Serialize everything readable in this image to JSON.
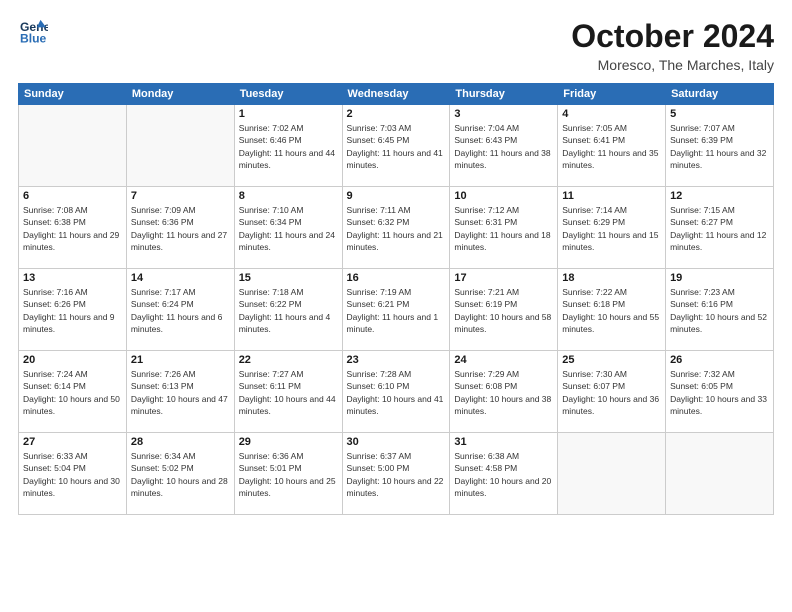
{
  "header": {
    "logo_line1": "General",
    "logo_line2": "Blue",
    "month": "October 2024",
    "location": "Moresco, The Marches, Italy"
  },
  "weekdays": [
    "Sunday",
    "Monday",
    "Tuesday",
    "Wednesday",
    "Thursday",
    "Friday",
    "Saturday"
  ],
  "weeks": [
    [
      {
        "day": "",
        "info": ""
      },
      {
        "day": "",
        "info": ""
      },
      {
        "day": "1",
        "info": "Sunrise: 7:02 AM\nSunset: 6:46 PM\nDaylight: 11 hours and 44 minutes."
      },
      {
        "day": "2",
        "info": "Sunrise: 7:03 AM\nSunset: 6:45 PM\nDaylight: 11 hours and 41 minutes."
      },
      {
        "day": "3",
        "info": "Sunrise: 7:04 AM\nSunset: 6:43 PM\nDaylight: 11 hours and 38 minutes."
      },
      {
        "day": "4",
        "info": "Sunrise: 7:05 AM\nSunset: 6:41 PM\nDaylight: 11 hours and 35 minutes."
      },
      {
        "day": "5",
        "info": "Sunrise: 7:07 AM\nSunset: 6:39 PM\nDaylight: 11 hours and 32 minutes."
      }
    ],
    [
      {
        "day": "6",
        "info": "Sunrise: 7:08 AM\nSunset: 6:38 PM\nDaylight: 11 hours and 29 minutes."
      },
      {
        "day": "7",
        "info": "Sunrise: 7:09 AM\nSunset: 6:36 PM\nDaylight: 11 hours and 27 minutes."
      },
      {
        "day": "8",
        "info": "Sunrise: 7:10 AM\nSunset: 6:34 PM\nDaylight: 11 hours and 24 minutes."
      },
      {
        "day": "9",
        "info": "Sunrise: 7:11 AM\nSunset: 6:32 PM\nDaylight: 11 hours and 21 minutes."
      },
      {
        "day": "10",
        "info": "Sunrise: 7:12 AM\nSunset: 6:31 PM\nDaylight: 11 hours and 18 minutes."
      },
      {
        "day": "11",
        "info": "Sunrise: 7:14 AM\nSunset: 6:29 PM\nDaylight: 11 hours and 15 minutes."
      },
      {
        "day": "12",
        "info": "Sunrise: 7:15 AM\nSunset: 6:27 PM\nDaylight: 11 hours and 12 minutes."
      }
    ],
    [
      {
        "day": "13",
        "info": "Sunrise: 7:16 AM\nSunset: 6:26 PM\nDaylight: 11 hours and 9 minutes."
      },
      {
        "day": "14",
        "info": "Sunrise: 7:17 AM\nSunset: 6:24 PM\nDaylight: 11 hours and 6 minutes."
      },
      {
        "day": "15",
        "info": "Sunrise: 7:18 AM\nSunset: 6:22 PM\nDaylight: 11 hours and 4 minutes."
      },
      {
        "day": "16",
        "info": "Sunrise: 7:19 AM\nSunset: 6:21 PM\nDaylight: 11 hours and 1 minute."
      },
      {
        "day": "17",
        "info": "Sunrise: 7:21 AM\nSunset: 6:19 PM\nDaylight: 10 hours and 58 minutes."
      },
      {
        "day": "18",
        "info": "Sunrise: 7:22 AM\nSunset: 6:18 PM\nDaylight: 10 hours and 55 minutes."
      },
      {
        "day": "19",
        "info": "Sunrise: 7:23 AM\nSunset: 6:16 PM\nDaylight: 10 hours and 52 minutes."
      }
    ],
    [
      {
        "day": "20",
        "info": "Sunrise: 7:24 AM\nSunset: 6:14 PM\nDaylight: 10 hours and 50 minutes."
      },
      {
        "day": "21",
        "info": "Sunrise: 7:26 AM\nSunset: 6:13 PM\nDaylight: 10 hours and 47 minutes."
      },
      {
        "day": "22",
        "info": "Sunrise: 7:27 AM\nSunset: 6:11 PM\nDaylight: 10 hours and 44 minutes."
      },
      {
        "day": "23",
        "info": "Sunrise: 7:28 AM\nSunset: 6:10 PM\nDaylight: 10 hours and 41 minutes."
      },
      {
        "day": "24",
        "info": "Sunrise: 7:29 AM\nSunset: 6:08 PM\nDaylight: 10 hours and 38 minutes."
      },
      {
        "day": "25",
        "info": "Sunrise: 7:30 AM\nSunset: 6:07 PM\nDaylight: 10 hours and 36 minutes."
      },
      {
        "day": "26",
        "info": "Sunrise: 7:32 AM\nSunset: 6:05 PM\nDaylight: 10 hours and 33 minutes."
      }
    ],
    [
      {
        "day": "27",
        "info": "Sunrise: 6:33 AM\nSunset: 5:04 PM\nDaylight: 10 hours and 30 minutes."
      },
      {
        "day": "28",
        "info": "Sunrise: 6:34 AM\nSunset: 5:02 PM\nDaylight: 10 hours and 28 minutes."
      },
      {
        "day": "29",
        "info": "Sunrise: 6:36 AM\nSunset: 5:01 PM\nDaylight: 10 hours and 25 minutes."
      },
      {
        "day": "30",
        "info": "Sunrise: 6:37 AM\nSunset: 5:00 PM\nDaylight: 10 hours and 22 minutes."
      },
      {
        "day": "31",
        "info": "Sunrise: 6:38 AM\nSunset: 4:58 PM\nDaylight: 10 hours and 20 minutes."
      },
      {
        "day": "",
        "info": ""
      },
      {
        "day": "",
        "info": ""
      }
    ]
  ]
}
